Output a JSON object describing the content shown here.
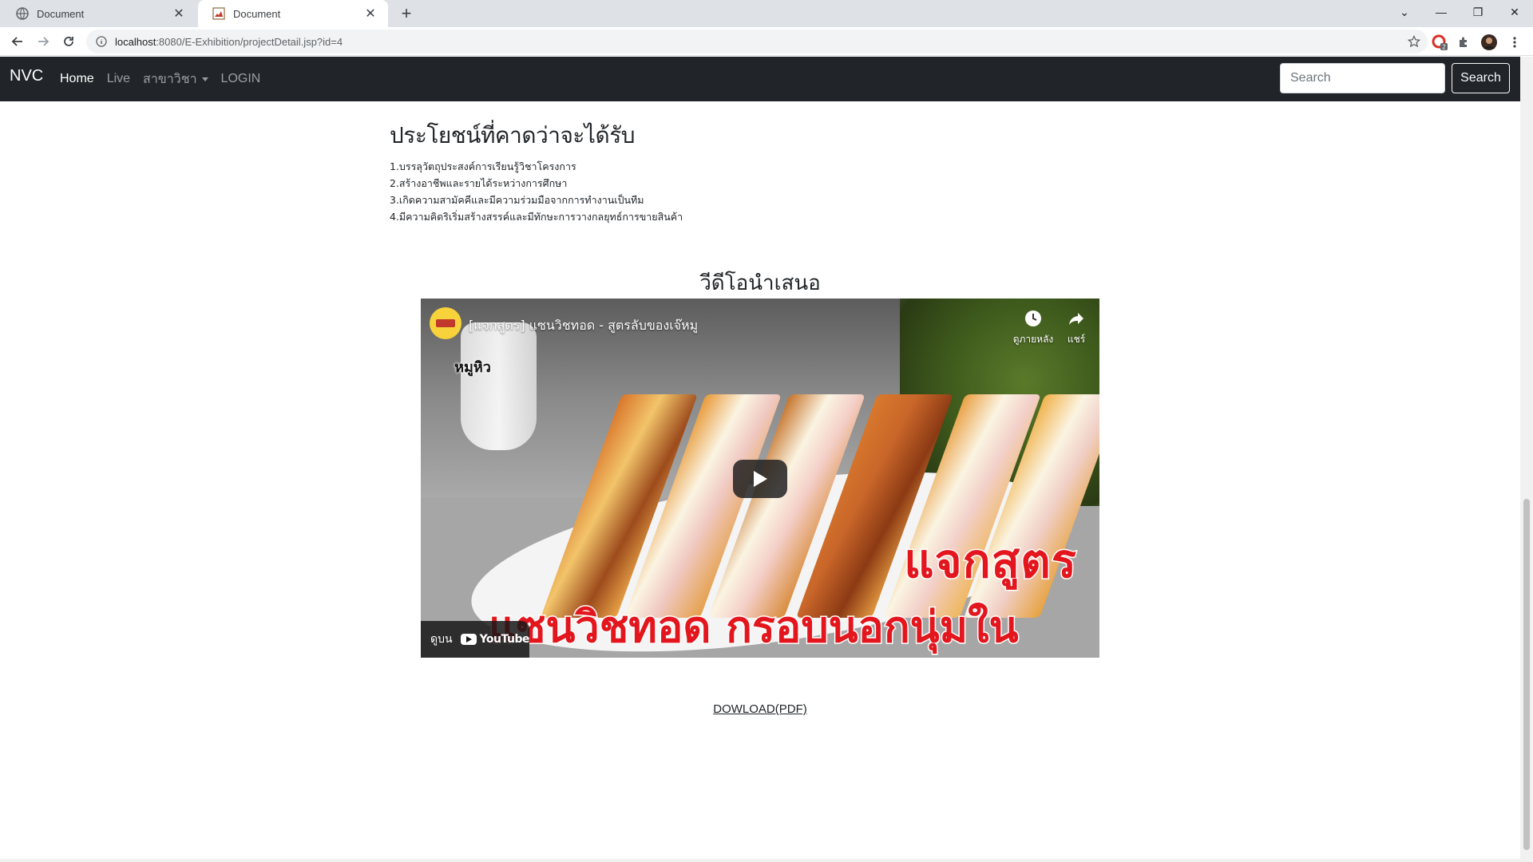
{
  "browser": {
    "tabs": [
      {
        "title": "Document",
        "active": false
      },
      {
        "title": "Document",
        "active": true
      }
    ],
    "url": {
      "host": "localhost",
      "path": ":8080/E-Exhibition/projectDetail.jsp?id=4"
    },
    "extension_badge": "2"
  },
  "navbar": {
    "brand": "NVC",
    "links": [
      {
        "label": "Home",
        "active": true
      },
      {
        "label": "Live",
        "active": false
      },
      {
        "label": "สาขาวิชา",
        "active": false,
        "dropdown": true
      },
      {
        "label": "LOGIN",
        "active": false
      }
    ],
    "search": {
      "placeholder": "Search",
      "button": "Search"
    }
  },
  "content": {
    "benefits_heading": "ประโยชน์ที่คาดว่าจะได้รับ",
    "benefits": [
      "1.บรรลุวัตถุประสงค์การเรียนรู้วิชาโครงการ",
      "2.สร้างอาชีพและรายได้ระหว่างการศึกษา",
      "3.เกิดความสามัคคีและมีความร่วมมือจากการทำงานเป็นทีม",
      "4.มีความคิดริเริ่มสร้างสรรค์และมีทักษะการวางกลยุทธ์การขายสินค้า"
    ],
    "video_heading": "วีดีโอนำเสนอ",
    "video": {
      "title": "[แจกสูตร] แซนวิชทอด - สูตรลับของเจ๊หมู",
      "watch_later": "ดูภายหลัง",
      "share": "แชร์",
      "overlay_line1": "แจกสูตร",
      "overlay_line2": "แซนวิชทอด กรอบนอกนุ่มใน",
      "mascot": "หมูหิว",
      "watch_on": "ดูบน",
      "youtube": "YouTube"
    },
    "download": "DOWLOAD(PDF)"
  },
  "colors": {
    "navbar_bg": "#212529",
    "overlay_red": "#e3161d"
  }
}
